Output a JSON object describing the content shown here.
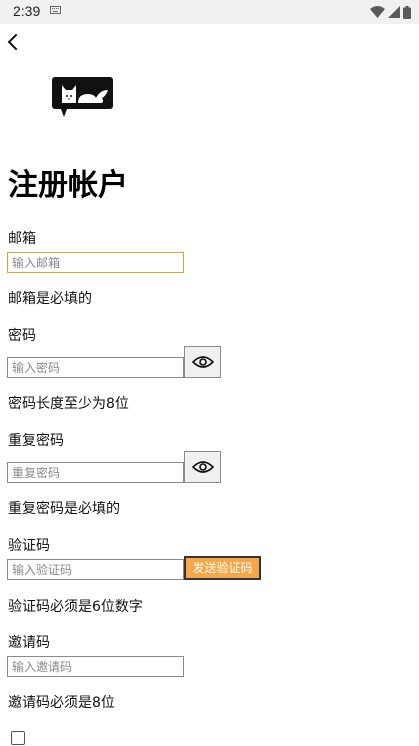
{
  "status_bar": {
    "time": "2:39"
  },
  "header": {
    "title": "注册帐户"
  },
  "form": {
    "email": {
      "label": "邮箱",
      "placeholder": "输入邮箱",
      "hint": "邮箱是必填的"
    },
    "password": {
      "label": "密码",
      "placeholder": "输入密码",
      "hint": "密码长度至少为8位"
    },
    "confirm_password": {
      "label": "重复密码",
      "placeholder": "重复密码",
      "hint": "重复密码是必填的"
    },
    "verification_code": {
      "label": "验证码",
      "placeholder": "输入验证码",
      "send_button": "发送验证码",
      "hint": "验证码必须是6位数字"
    },
    "invite_code": {
      "label": "邀请码",
      "placeholder": "输入邀请码",
      "hint": "邀请码必须是8位"
    }
  },
  "colors": {
    "accent": "#f4a84a",
    "focus_border": "#e0a22a"
  }
}
